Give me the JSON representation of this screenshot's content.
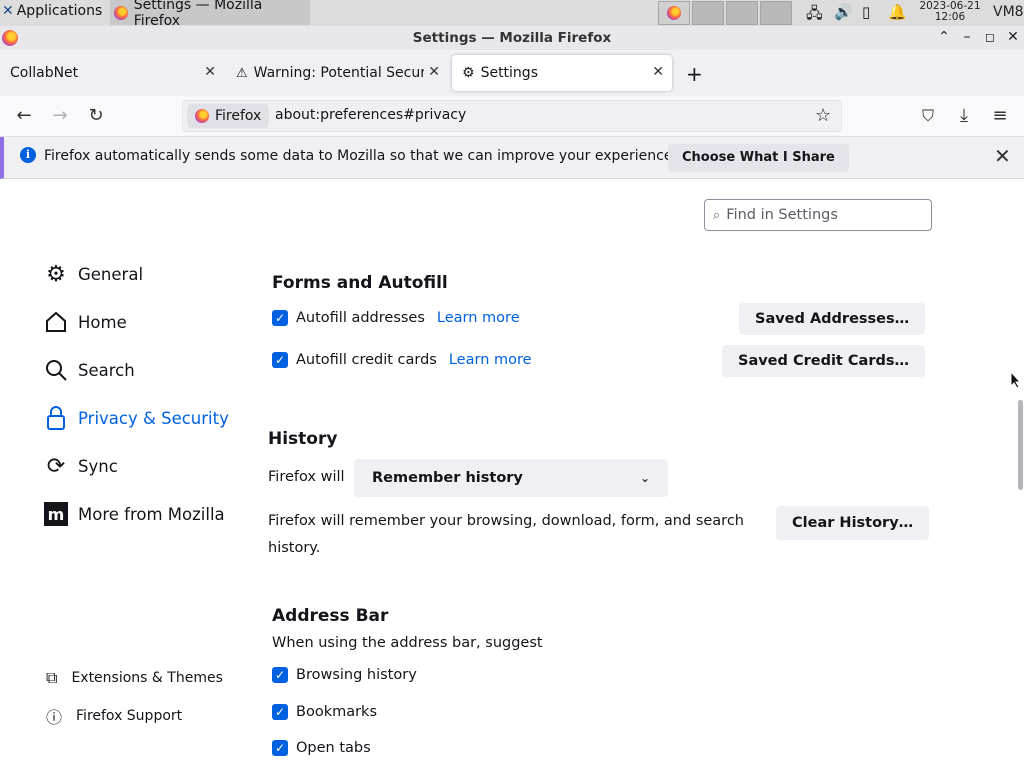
{
  "taskbar": {
    "apps_label": "Applications",
    "task_title": "Settings — Mozilla Firefox",
    "clock_date": "2023-06-21",
    "clock_time": "12:06",
    "vm_label": "VM8"
  },
  "window": {
    "title": "Settings — Mozilla Firefox"
  },
  "tabs": [
    {
      "label": "CollabNet"
    },
    {
      "label": "Warning: Potential Security Risk Ahead"
    },
    {
      "label": "Settings"
    }
  ],
  "nav": {
    "identity_label": "Firefox",
    "url": "about:preferences#privacy"
  },
  "notification": {
    "message": "Firefox automatically sends some data to Mozilla so that we can improve your experience.",
    "button": "Choose What I Share"
  },
  "search": {
    "placeholder": "Find in Settings"
  },
  "sidebar": {
    "items": [
      {
        "label": "General",
        "icon": "gear-icon"
      },
      {
        "label": "Home",
        "icon": "home-icon"
      },
      {
        "label": "Search",
        "icon": "search-icon"
      },
      {
        "label": "Privacy & Security",
        "icon": "lock-icon"
      },
      {
        "label": "Sync",
        "icon": "sync-icon"
      },
      {
        "label": "More from Mozilla",
        "icon": "mozilla-icon"
      }
    ],
    "footer": [
      {
        "label": "Extensions & Themes",
        "icon": "puzzle-icon"
      },
      {
        "label": "Firefox Support",
        "icon": "help-icon"
      }
    ]
  },
  "forms": {
    "heading": "Forms and Autofill",
    "autofill_addresses": "Autofill addresses",
    "autofill_cards": "Autofill credit cards",
    "learn_more": "Learn more",
    "saved_addresses": "Saved Addresses…",
    "saved_cards": "Saved Credit Cards…"
  },
  "history": {
    "heading": "History",
    "firefox_will": "Firefox will",
    "mode": "Remember history",
    "description": "Firefox will remember your browsing, download, form, and search history.",
    "clear_button": "Clear History…"
  },
  "address_bar": {
    "heading": "Address Bar",
    "subtitle": "When using the address bar, suggest",
    "options": [
      "Browsing history",
      "Bookmarks",
      "Open tabs"
    ]
  },
  "colors": {
    "accent": "#0061e0",
    "notification_bar": "#8f6fe6"
  }
}
